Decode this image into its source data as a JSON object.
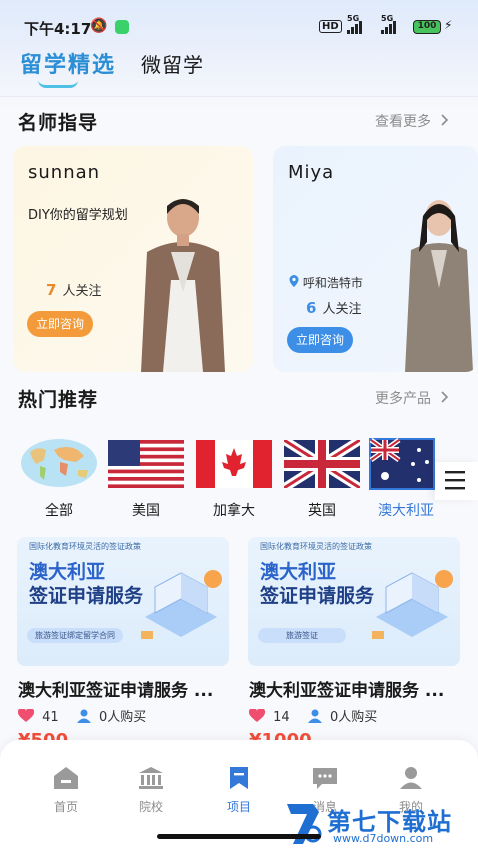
{
  "status_bar": {
    "time": "下午4:17",
    "hd": "HD",
    "sig1": "5G",
    "sig2": "5G",
    "battery": "100"
  },
  "tabs": [
    {
      "label": "留学精选",
      "active": true
    },
    {
      "label": "微留学",
      "active": false
    }
  ],
  "teachers_section": {
    "title": "名师指导",
    "more": "查看更多"
  },
  "teachers": [
    {
      "name": "sunnan",
      "desc": "DIY你的留学规划",
      "follow_count": "7",
      "follow_label": "人关注",
      "button": "立即咨询"
    },
    {
      "name": "Miya",
      "location": "呼和浩特市",
      "follow_count": "6",
      "follow_label": "人关注",
      "button": "立即咨询"
    }
  ],
  "hot_section": {
    "title": "热门推荐",
    "more": "更多产品"
  },
  "countries": [
    {
      "label": "全部",
      "flag": "world-map"
    },
    {
      "label": "美国",
      "flag": "usa-flag"
    },
    {
      "label": "加拿大",
      "flag": "canada-flag"
    },
    {
      "label": "英国",
      "flag": "uk-flag"
    },
    {
      "label": "澳大利亚",
      "flag": "australia-flag",
      "active": true
    }
  ],
  "products": [
    {
      "banner_small": "国际化教育环境灵活的签证政策",
      "banner_line1": "澳大利亚",
      "banner_line2": "签证申请服务",
      "banner_tag": "旅游签证绑定留学合同",
      "title": "澳大利亚签证申请服务 ...",
      "likes": "41",
      "buyers": "0人购买",
      "price": "¥500"
    },
    {
      "banner_small": "国际化教育环境灵活的签证政策",
      "banner_line1": "澳大利亚",
      "banner_line2": "签证申请服务",
      "banner_tag": "旅游签证",
      "title": "澳大利亚签证申请服务 ...",
      "likes": "14",
      "buyers": "0人购买",
      "price": "¥1000"
    }
  ],
  "bottom_nav": [
    {
      "label": "首页",
      "icon": "home-icon"
    },
    {
      "label": "院校",
      "icon": "school-icon"
    },
    {
      "label": "项目",
      "icon": "project-icon",
      "active": true
    },
    {
      "label": "消息",
      "icon": "message-icon"
    },
    {
      "label": "我的",
      "icon": "profile-icon"
    }
  ],
  "watermark": {
    "text": "第七下载站",
    "url": "www.d7down.com"
  },
  "colors": {
    "accent": "#3479d9",
    "orange": "#f39b3a",
    "tab_active": "#2c8fd6"
  }
}
